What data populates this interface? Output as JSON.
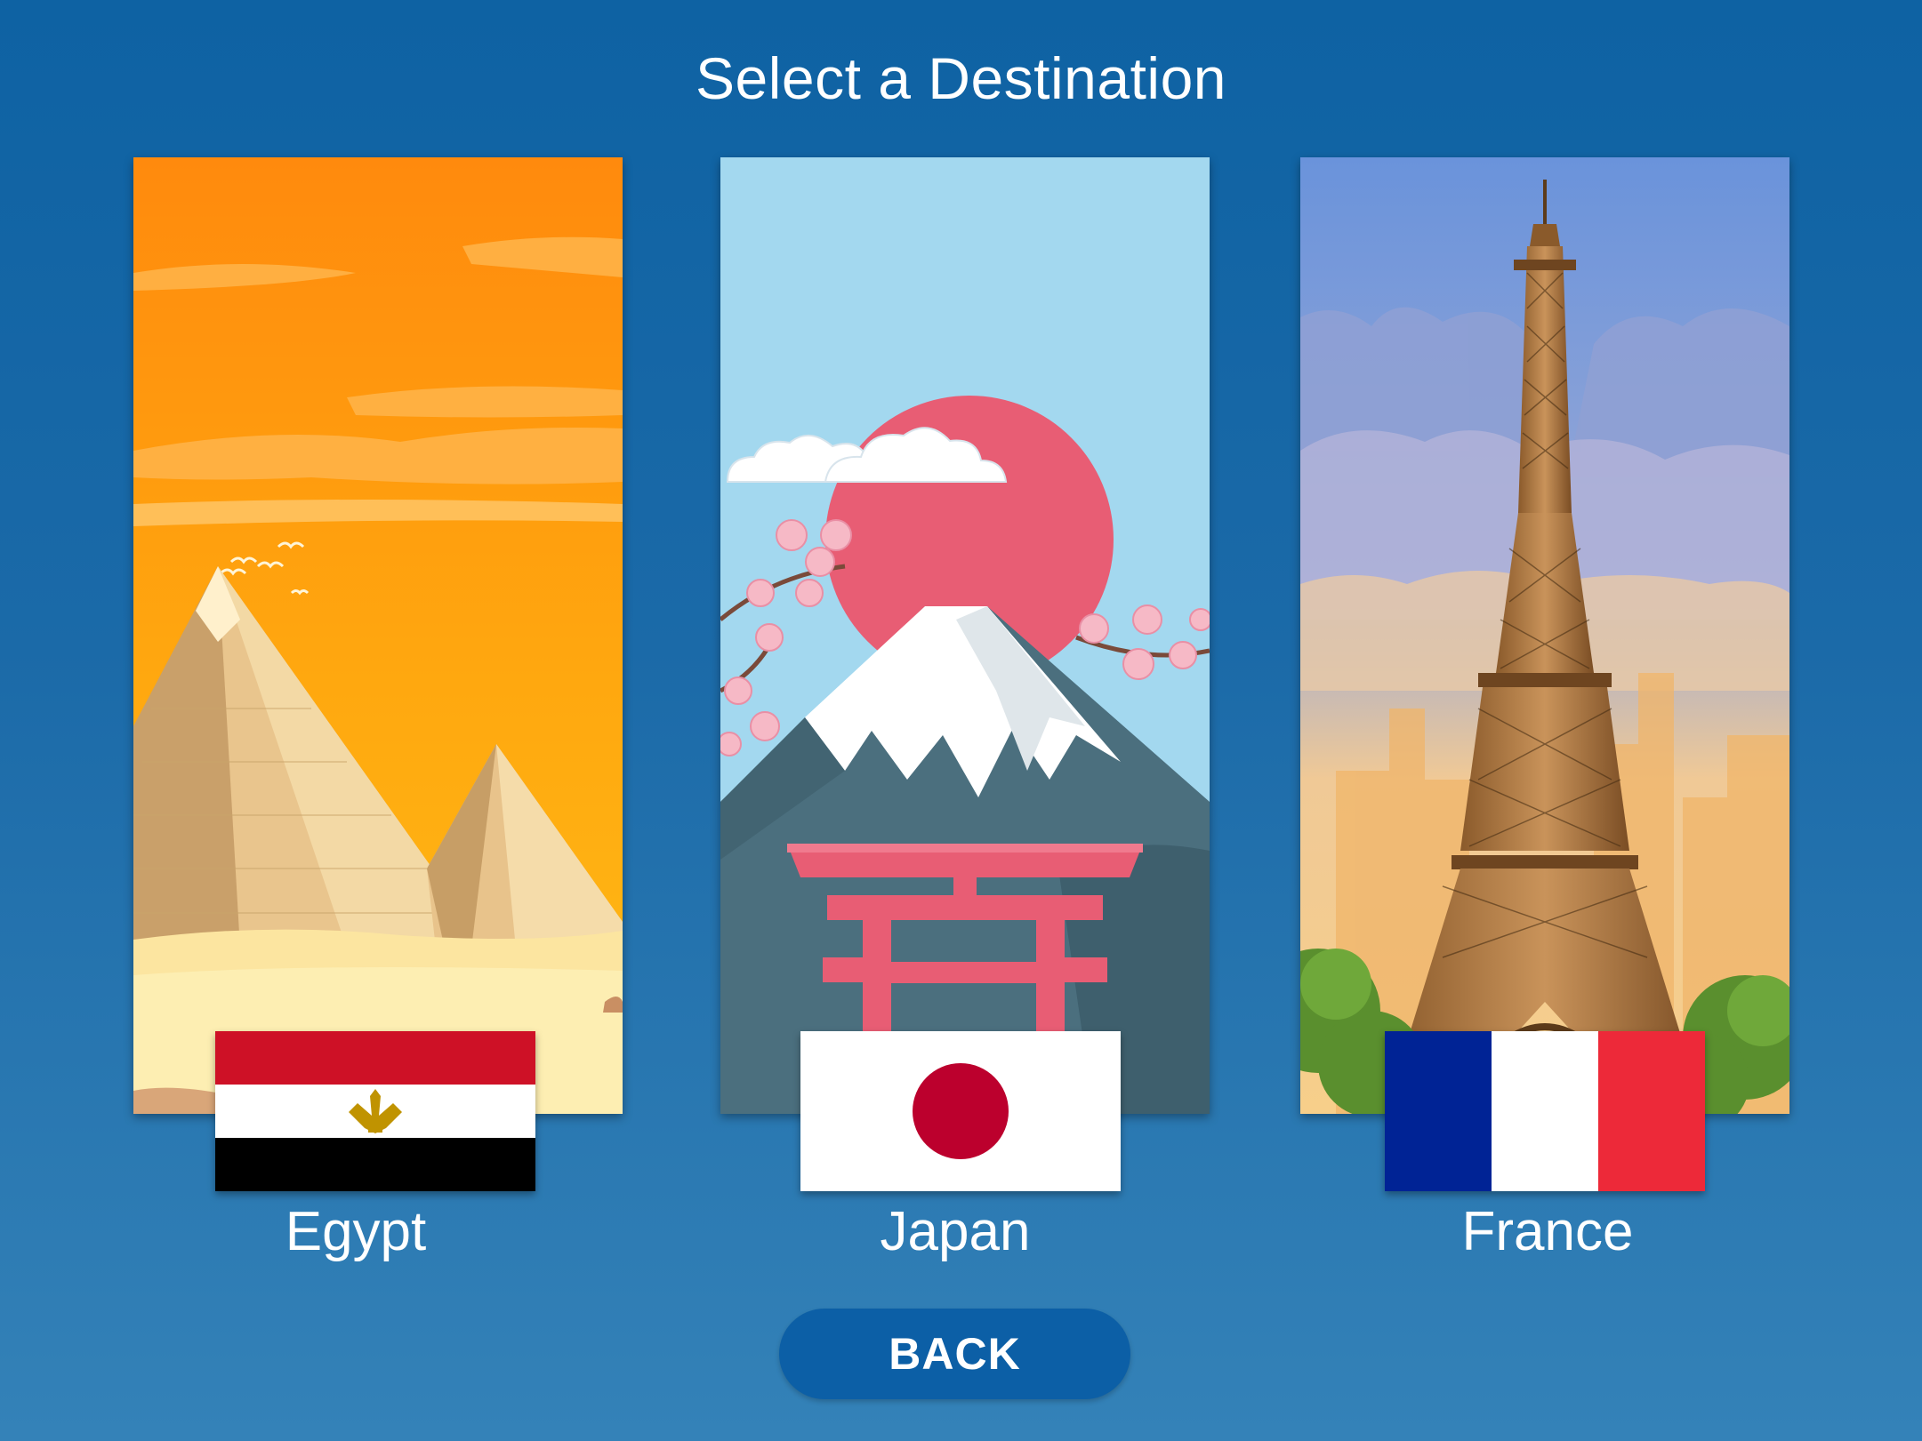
{
  "screen": {
    "title": "Select a Destination",
    "back_label": "BACK"
  },
  "destinations": [
    {
      "id": "egypt",
      "name": "Egypt",
      "scene_icon": "pyramids-icon",
      "flag_icon": "egypt-flag-icon"
    },
    {
      "id": "japan",
      "name": "Japan",
      "scene_icon": "mount-fuji-torii-icon",
      "flag_icon": "japan-flag-icon"
    },
    {
      "id": "france",
      "name": "France",
      "scene_icon": "eiffel-tower-icon",
      "flag_icon": "france-flag-icon"
    }
  ],
  "colors": {
    "background_top": "#0e62a3",
    "background_bottom": "#3482b8",
    "button": "#0c5fa6",
    "egypt_red": "#ce1126",
    "japan_red": "#bc002d",
    "france_blue": "#002395",
    "france_red": "#ed2939"
  }
}
